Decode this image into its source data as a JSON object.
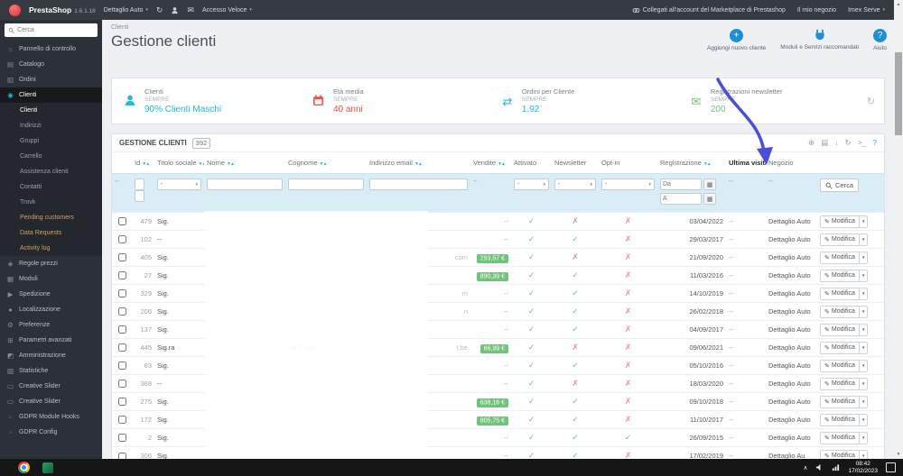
{
  "colors": {
    "accent": "#25b9d7",
    "success": "#72c279",
    "danger": "#e08f95",
    "annotation_arrow": "#4b4fd6"
  },
  "glyphs": {
    "caret": "▾",
    "sort": "▼▲",
    "dash": "--",
    "refresh": "↻",
    "envelope": "✉",
    "edit": "✎",
    "calendar": "▦",
    "plus": "+",
    "question": "?",
    "arrows": "⇄",
    "chevron_up": "∧",
    "up": "▲",
    "down": "▼"
  },
  "topbar": {
    "brand": "PrestaShop",
    "version": "1.6.1.18",
    "shop_selector": "Dettaglio Auto",
    "quick_access": "Accesso Veloce",
    "marketplace": "Collegati all'account del Marketplace di Prestashop",
    "my_shop": "Il mio negozio",
    "user_menu": "Imex Serve"
  },
  "sidebar": {
    "search_placeholder": "Cerca",
    "items": [
      {
        "name": "sidebar-item-pannello-di-controllo",
        "label": "Pannello di controllo",
        "glyph": "⌂",
        "cls": ""
      },
      {
        "name": "sidebar-item-catalogo",
        "label": "Catalogo",
        "glyph": "▤",
        "cls": ""
      },
      {
        "name": "sidebar-item-ordini",
        "label": "Ordini",
        "glyph": "▥",
        "cls": ""
      },
      {
        "name": "sidebar-item-clienti",
        "label": "Clienti",
        "glyph": "◉",
        "cls": "active"
      },
      {
        "name": "sidebar-subitem-clienti",
        "label": "Clienti",
        "glyph": "",
        "cls": "sub current"
      },
      {
        "name": "sidebar-subitem-indirizzi",
        "label": "Indirizzi",
        "glyph": "",
        "cls": "sub"
      },
      {
        "name": "sidebar-subitem-gruppi",
        "label": "Gruppi",
        "glyph": "",
        "cls": "sub"
      },
      {
        "name": "sidebar-subitem-carrello",
        "label": "Carrello",
        "glyph": "",
        "cls": "sub"
      },
      {
        "name": "sidebar-subitem-assistenza-clienti",
        "label": "Assistenza clienti",
        "glyph": "",
        "cls": "sub"
      },
      {
        "name": "sidebar-subitem-contatti",
        "label": "Contatti",
        "glyph": "",
        "cls": "sub"
      },
      {
        "name": "sidebar-subitem-trovk",
        "label": "Trovk",
        "glyph": "",
        "cls": "sub"
      },
      {
        "name": "sidebar-subitem-pending-customers",
        "label": "Pending customers",
        "glyph": "",
        "cls": "sub accent"
      },
      {
        "name": "sidebar-subitem-data-requests",
        "label": "Data Requests",
        "glyph": "",
        "cls": "sub accent"
      },
      {
        "name": "sidebar-subitem-activity-log",
        "label": "Activity log",
        "glyph": "",
        "cls": "sub accent"
      },
      {
        "name": "sidebar-item-regole-prezzi",
        "label": "Regole prezzi",
        "glyph": "◈",
        "cls": ""
      },
      {
        "name": "sidebar-item-moduli",
        "label": "Moduli",
        "glyph": "▦",
        "cls": ""
      },
      {
        "name": "sidebar-item-spedizione",
        "label": "Spedizione",
        "glyph": "▶",
        "cls": ""
      },
      {
        "name": "sidebar-item-localizzazione",
        "label": "Localizzazione",
        "glyph": "●",
        "cls": ""
      },
      {
        "name": "sidebar-item-preferenze",
        "label": "Preferenze",
        "glyph": "⚙",
        "cls": ""
      },
      {
        "name": "sidebar-item-parametri-avanzati",
        "label": "Parametri avanzati",
        "glyph": "⊞",
        "cls": ""
      },
      {
        "name": "sidebar-item-amministrazione",
        "label": "Amministrazione",
        "glyph": "◩",
        "cls": ""
      },
      {
        "name": "sidebar-item-statistiche",
        "label": "Statistiche",
        "glyph": "▧",
        "cls": ""
      },
      {
        "name": "sidebar-item-creative-slider-1",
        "label": "Creative Slider",
        "glyph": "▭",
        "cls": ""
      },
      {
        "name": "sidebar-item-creative-slider-2",
        "label": "Creative Slider",
        "glyph": "▭",
        "cls": ""
      },
      {
        "name": "sidebar-item-gdpr-module-hooks",
        "label": "GDPR Module Hooks",
        "glyph": "▫",
        "cls": ""
      },
      {
        "name": "sidebar-item-gdpr-config",
        "label": "GDPR Config",
        "glyph": "▫",
        "cls": ""
      }
    ]
  },
  "page": {
    "breadcrumb": "Clienti",
    "title": "Gestione clienti",
    "actions": {
      "add": "Aggiungi nuovo cliente",
      "modules": "Moduli e Servizi raccomandati",
      "help": "Aiuto"
    }
  },
  "kpis": [
    {
      "label": "Clienti",
      "period": "SEMPRE",
      "value": "90% Clienti Maschi",
      "color": "#25b9d7"
    },
    {
      "label": "Età media",
      "period": "SEMPRE",
      "value": "40 anni",
      "color": "#f54c3e"
    },
    {
      "label": "Ordini per Cliente",
      "period": "SEMPRE",
      "value": "1.92",
      "color": "#25b9d7",
      "glyph": "⇄"
    },
    {
      "label": "Registrazioni newsletter",
      "period": "SEMPRE",
      "value": "200",
      "color": "#72c279",
      "glyph": "✉"
    }
  ],
  "panel": {
    "title": "GESTIONE CLIENTI",
    "count": "392",
    "icons": [
      {
        "name": "panel-add-icon",
        "glyph": "⊕",
        "cls": ""
      },
      {
        "name": "panel-grid-icon",
        "glyph": "▤",
        "cls": ""
      },
      {
        "name": "panel-export-icon",
        "glyph": "↓",
        "cls": ""
      },
      {
        "name": "panel-refresh-icon",
        "glyph": "↻",
        "cls": ""
      },
      {
        "name": "panel-sql-icon",
        "glyph": ">_",
        "cls": ""
      },
      {
        "name": "panel-help-icon",
        "glyph": "?",
        "cls": "blue"
      }
    ]
  },
  "table": {
    "columns": {
      "id": "Id",
      "titolo": "Titolo sociale",
      "nome": "Nome",
      "cognome": "Cognome",
      "email": "Indirizzo email",
      "vendite": "Vendite",
      "attivato": "Attivato",
      "newsletter": "Newsletter",
      "optin": "Opt-in",
      "registrazione": "Registrazione",
      "ultima": "Ultima visita",
      "negozio": "Negozio"
    },
    "filters": {
      "select_value": "-",
      "date_from": "Da",
      "date_to": "A",
      "search": "Cerca"
    },
    "edit": "Modifica",
    "rows": [
      {
        "id": "479",
        "titolo": "Sig.",
        "nome": "",
        "cognome": "",
        "email": "",
        "badge": "",
        "vdash": "--",
        "att": "✓",
        "att_c": "ok",
        "nl": "✗",
        "nl_c": "no",
        "oi": "✗",
        "oi_c": "no",
        "reg": "03/04/2022",
        "last": "--",
        "shop": "Dettaglio Auto"
      },
      {
        "id": "102",
        "titolo": "--",
        "nome": "",
        "cognome": "",
        "email": "",
        "badge": "",
        "vdash": "--",
        "att": "✓",
        "att_c": "ok",
        "nl": "✓",
        "nl_c": "ok",
        "oi": "✗",
        "oi_c": "no",
        "reg": "29/03/2017",
        "last": "--",
        "shop": "Dettaglio Auto"
      },
      {
        "id": "405",
        "titolo": "Sig.",
        "nome": "",
        "cognome": "",
        "email": "com",
        "badge": "293,57 €",
        "vdash": "",
        "att": "✓",
        "att_c": "ok",
        "nl": "✗",
        "nl_c": "no",
        "oi": "✗",
        "oi_c": "no",
        "reg": "21/09/2020",
        "last": "--",
        "shop": "Dettaglio Auto"
      },
      {
        "id": "27",
        "titolo": "Sig.",
        "nome": "",
        "cognome": "",
        "email": "",
        "badge": "890,39 €",
        "vdash": "",
        "att": "✓",
        "att_c": "ok",
        "nl": "✓",
        "nl_c": "ok",
        "oi": "✗",
        "oi_c": "no",
        "reg": "11/03/2016",
        "last": "--",
        "shop": "Dettaglio Auto"
      },
      {
        "id": "329",
        "titolo": "Sig.",
        "nome": "",
        "cognome": "",
        "email": "m",
        "badge": "",
        "vdash": "--",
        "att": "✓",
        "att_c": "ok",
        "nl": "✓",
        "nl_c": "ok",
        "oi": "✗",
        "oi_c": "no",
        "reg": "14/10/2019",
        "last": "--",
        "shop": "Dettaglio Auto"
      },
      {
        "id": "206",
        "titolo": "Sig.",
        "nome": "",
        "cognome": "",
        "email": "n",
        "badge": "",
        "vdash": "--",
        "att": "✓",
        "att_c": "ok",
        "nl": "✓",
        "nl_c": "ok",
        "oi": "✗",
        "oi_c": "no",
        "reg": "26/02/2018",
        "last": "--",
        "shop": "Dettaglio Auto"
      },
      {
        "id": "137",
        "titolo": "Sig.",
        "nome": "",
        "cognome": "",
        "email": "",
        "badge": "",
        "vdash": "--",
        "att": "✓",
        "att_c": "ok",
        "nl": "✓",
        "nl_c": "ok",
        "oi": "✗",
        "oi_c": "no",
        "reg": "04/09/2017",
        "last": "--",
        "shop": "Dettaglio Auto"
      },
      {
        "id": "445",
        "titolo": "Sig.ra",
        "nome": "",
        "cognome": "Da Parijs",
        "email": "t.be",
        "badge": "66,99 €",
        "vdash": "",
        "att": "✓",
        "att_c": "ok",
        "nl": "✗",
        "nl_c": "no",
        "oi": "✗",
        "oi_c": "no",
        "reg": "09/06/2021",
        "last": "--",
        "shop": "Dettaglio Auto"
      },
      {
        "id": "63",
        "titolo": "Sig.",
        "nome": "",
        "cognome": "",
        "email": "",
        "badge": "",
        "vdash": "--",
        "att": "✓",
        "att_c": "ok",
        "nl": "✓",
        "nl_c": "ok",
        "oi": "✗",
        "oi_c": "no",
        "reg": "05/10/2016",
        "last": "--",
        "shop": "Dettaglio Auto"
      },
      {
        "id": "368",
        "titolo": "--",
        "nome": "",
        "cognome": "",
        "email": "",
        "badge": "",
        "vdash": "--",
        "att": "✓",
        "att_c": "ok",
        "nl": "✗",
        "nl_c": "no",
        "oi": "✗",
        "oi_c": "no",
        "reg": "18/03/2020",
        "last": "--",
        "shop": "Dettaglio Auto"
      },
      {
        "id": "275",
        "titolo": "Sig.",
        "nome": "",
        "cognome": "",
        "email": "",
        "badge": "638,16 €",
        "vdash": "",
        "att": "✓",
        "att_c": "ok",
        "nl": "✓",
        "nl_c": "ok",
        "oi": "✗",
        "oi_c": "no",
        "reg": "09/10/2018",
        "last": "--",
        "shop": "Dettaglio Auto"
      },
      {
        "id": "172",
        "titolo": "Sig.",
        "nome": "",
        "cognome": "",
        "email": "",
        "badge": "805,75 €",
        "vdash": "",
        "att": "✓",
        "att_c": "ok",
        "nl": "✓",
        "nl_c": "ok",
        "oi": "✗",
        "oi_c": "no",
        "reg": "11/10/2017",
        "last": "--",
        "shop": "Dettaglio Auto"
      },
      {
        "id": "2",
        "titolo": "Sig.",
        "nome": "",
        "cognome": "",
        "email": "",
        "badge": "",
        "vdash": "--",
        "att": "✓",
        "att_c": "ok",
        "nl": "✓",
        "nl_c": "ok",
        "oi": "✓",
        "oi_c": "ok",
        "reg": "26/09/2015",
        "last": "--",
        "shop": "Dettaglio Auto"
      },
      {
        "id": "306",
        "titolo": "Sig.",
        "nome": "",
        "cognome": "",
        "email": "",
        "badge": "",
        "vdash": "--",
        "att": "✓",
        "att_c": "ok",
        "nl": "✓",
        "nl_c": "ok",
        "oi": "✗",
        "oi_c": "no",
        "reg": "17/02/2019",
        "last": "--",
        "shop": "Dettaglio Au"
      }
    ]
  },
  "taskbar": {
    "time": "08:42",
    "date": "17/02/2023"
  }
}
